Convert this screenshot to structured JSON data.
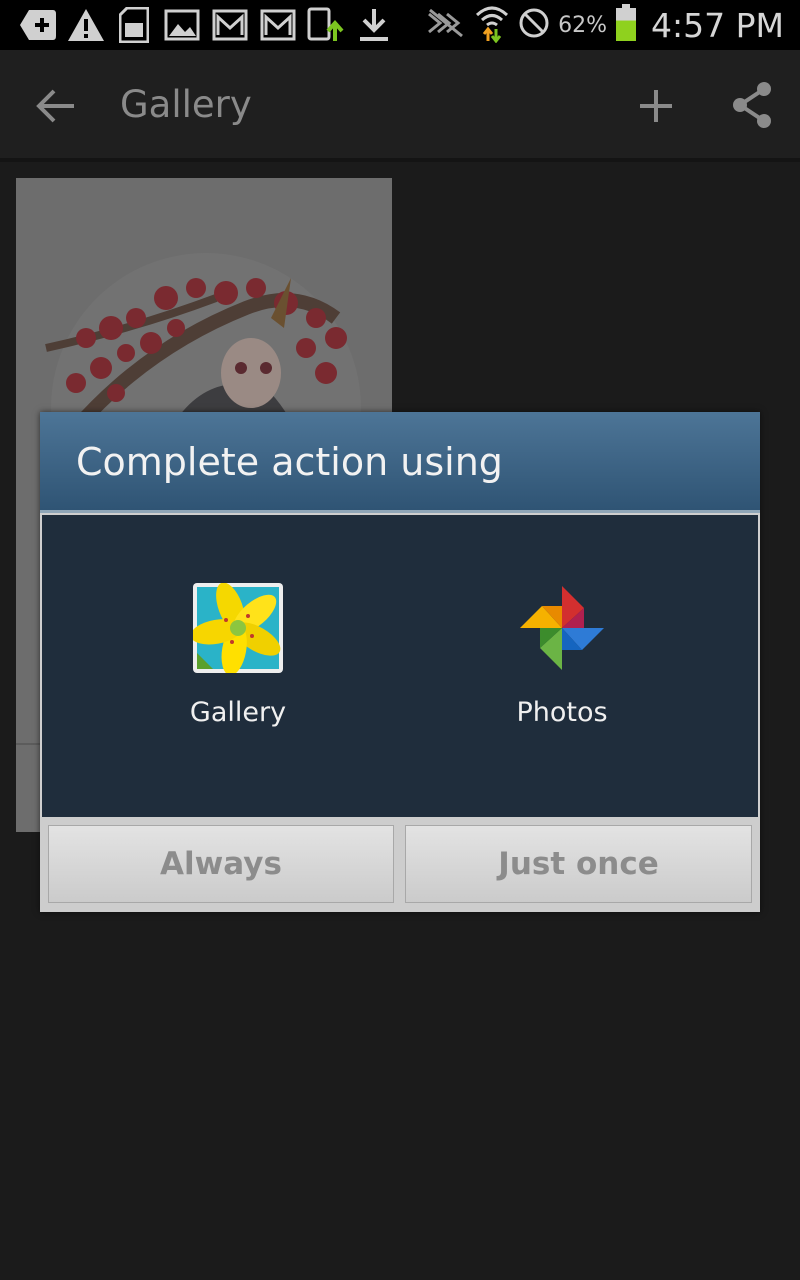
{
  "status_bar": {
    "left_icons": [
      "add-notification-icon",
      "warning-icon",
      "sd-card-icon",
      "image-icon",
      "gmail-icon",
      "gmail-icon",
      "sync-icon",
      "download-icon"
    ],
    "right_icons": [
      "nfc-icon",
      "wifi-icon",
      "blocked-icon"
    ],
    "battery_percent": "62%",
    "battery_level": 0.62,
    "time": "4:57 PM"
  },
  "action_bar": {
    "title": "Gallery",
    "icons": [
      "back-arrow-icon",
      "add-icon",
      "share-icon"
    ]
  },
  "dialog": {
    "title": "Complete action using",
    "apps": [
      {
        "label": "Gallery",
        "icon": "gallery-app-icon"
      },
      {
        "label": "Photos",
        "icon": "photos-pinwheel-icon"
      }
    ],
    "buttons": {
      "always": "Always",
      "just_once": "Just once"
    }
  },
  "colors": {
    "dialog_header": "#3f678a",
    "dialog_body": "#1f2d3c",
    "battery": "#8fd11e"
  }
}
